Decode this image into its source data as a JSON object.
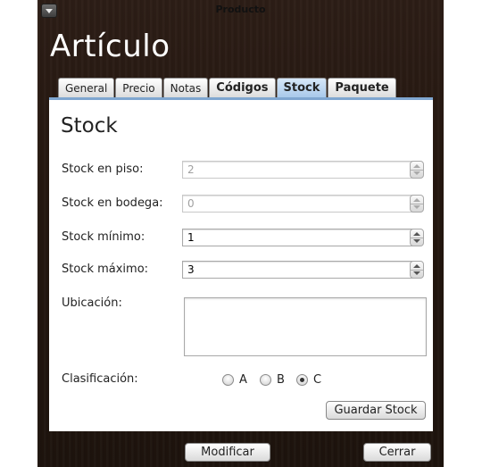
{
  "window": {
    "title": "Producto"
  },
  "heading": "Artículo",
  "tabs": [
    {
      "label": "General",
      "active": false
    },
    {
      "label": "Precio",
      "active": false
    },
    {
      "label": "Notas",
      "active": false
    },
    {
      "label": "Códigos",
      "active": false
    },
    {
      "label": "Stock",
      "active": true
    },
    {
      "label": "Paquete",
      "active": false
    }
  ],
  "section": {
    "title": "Stock"
  },
  "fields": {
    "stock_piso": {
      "label": "Stock en piso:",
      "value": "2",
      "enabled": false
    },
    "stock_bodega": {
      "label": "Stock en bodega:",
      "value": "0",
      "enabled": false
    },
    "stock_minimo": {
      "label": "Stock mínimo:",
      "value": "1",
      "enabled": true
    },
    "stock_maximo": {
      "label": "Stock máximo:",
      "value": "3",
      "enabled": true
    },
    "ubicacion": {
      "label": "Ubicación:",
      "value": ""
    }
  },
  "clasificacion": {
    "label": "Clasificación:",
    "options": [
      "A",
      "B",
      "C"
    ],
    "selected": "C"
  },
  "buttons": {
    "guardar": "Guardar Stock",
    "modificar": "Modificar",
    "cerrar": "Cerrar"
  }
}
